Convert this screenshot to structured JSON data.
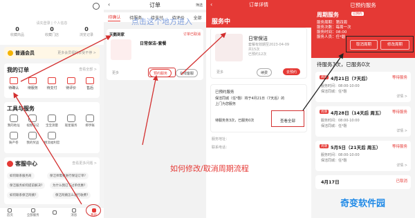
{
  "panel1": {
    "login_prompt": "请先登录 | 个人信息",
    "stats": [
      {
        "value": "0",
        "label": "收藏商品"
      },
      {
        "value": "0",
        "label": "收藏门店"
      },
      {
        "value": "0",
        "label": "浏览记录"
      }
    ],
    "member": {
      "title": "普通会员",
      "text": "更多会员福利享受不停 >"
    },
    "my_orders": {
      "title": "我的订单",
      "more": "查看全部 >",
      "items": [
        "待确认",
        "待服务",
        "待支付",
        "待评价",
        "售后"
      ]
    },
    "tools": {
      "title": "工具与服务",
      "items": [
        "我的地址",
        "视频日记",
        "宝宝测量",
        "观星服务",
        "绑手账",
        "铸产卷",
        "我的奖品",
        "物流福利官",
        "",
        ""
      ]
    },
    "service": {
      "title": "客服中心",
      "more": "查看更多问题 >",
      "questions": [
        "如何联系服务商",
        "保洁师需要进行保证订单?",
        "保洁服务如何提前解决?",
        "为什么我已下过单优惠?",
        "如何联系保洁阿姨?",
        "保洁阿姨怎么进行收费?"
      ]
    },
    "nav": [
      "首页",
      "全部服务",
      "",
      "消息",
      "我的"
    ]
  },
  "panel2": {
    "title": "订单",
    "filter": "筛选",
    "tabs": [
      "待确认",
      "待服务",
      "待支付",
      "待评价",
      "全部"
    ],
    "store": "天鹅到家",
    "status": "订单已取消",
    "product": "日常保洁-套餐",
    "overlay": "点击这个地方进入",
    "more": "更多",
    "btn_book": "预约服务",
    "btn_service": "在线客服"
  },
  "panel3": {
    "title": "订单详情",
    "hero": "服务中",
    "product": "日常保洁",
    "line1": "套餐有效期至2023-04-09",
    "line2": "共15次",
    "line3": "已预约12次",
    "more": "更多",
    "btn_renew": "续费",
    "btn_book": "去预约",
    "booked_title": "已预约服务",
    "booked_line1": "保洁同城（任*磬）将于4月21日（7天后）的",
    "booked_line2": "上门为您服务",
    "booked_line3": "待服务务3次，已服务0次",
    "view_all": "查看全部",
    "addr_label": "服务地址：",
    "contact_label": "联系电话：",
    "caption": "如何修改/取消周期流程"
  },
  "panel4": {
    "title": "已预约服务",
    "period": "周期服务",
    "badge": "已预约",
    "info": [
      "服务周期：第四周",
      "服务次数：每周一次",
      "服务时间：08:00",
      "服务人员：任*磬"
    ],
    "btn_cancel": "取消周期",
    "btn_modify": "修改周期",
    "summary": "待服务3次，已服务0次",
    "slots": [
      {
        "tag": "周期",
        "date": "4月21日（7天后）",
        "status": "等待服务",
        "time": "服务时间：08:00-10:00",
        "staff": "保洁同城：任*磬",
        "detail": "详情 >"
      },
      {
        "tag": "周期",
        "date": "4月28日（14天后 周五）",
        "status": "等待服务",
        "time": "服务时间：08:00-10:00",
        "staff": "保洁同城：任*磬",
        "detail": "详情 >"
      },
      {
        "tag": "周期",
        "date": "5月5日（21天后 周五）",
        "status": "等待服务",
        "time": "服务时间：08:00-10:00",
        "staff": "保洁同城：任*磬",
        "detail": "详情 >"
      }
    ],
    "last_date": "4月17日",
    "last_status": "已取消",
    "watermark": "奇变软件园"
  },
  "colors": {
    "accent": "#e53935",
    "annotation": "#d32f2f",
    "watermark": "#1e88e5"
  }
}
